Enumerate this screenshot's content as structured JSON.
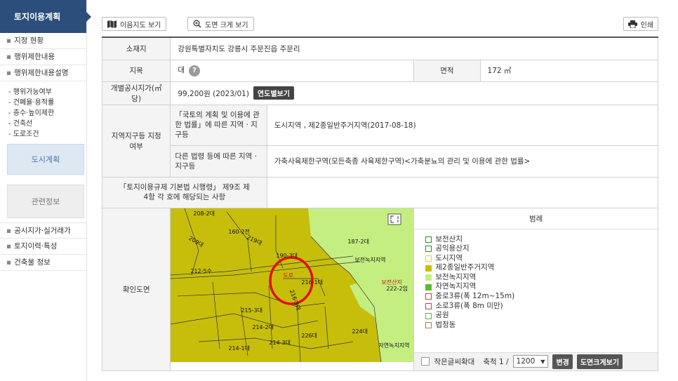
{
  "sidebar": {
    "header": "토지이용계획",
    "items_top": [
      "지정 현황",
      "행위제한내용",
      "행위제한내용설명"
    ],
    "sub_items": [
      "- 행위가능여부",
      "- 건폐율·용적률",
      "- 층수·높이제한",
      "- 건축선",
      "- 도로조건"
    ],
    "box_city": "도시계획",
    "box_related": "관련정보",
    "items_bottom": [
      "공시지가·실거래가",
      "토지이력·특성",
      "건축물 정보"
    ]
  },
  "toolbar": {
    "map_button": "이음지도 보기",
    "zoom_button": "도면 크게 보기",
    "print_button": "인쇄"
  },
  "info": {
    "location_label": "소재지",
    "location_value": "강원특별자치도 강릉시 주문진읍 주문리",
    "jimok_label": "지목",
    "jimok_value": "대",
    "area_label": "면적",
    "area_value": "172 ㎡",
    "price_label": "개별공시지가(㎡당)",
    "price_value": "99,200원 (2023/01)",
    "price_badge": "연도별보기",
    "zone_label": "지역지구등 지정여부",
    "zone1_label": "「국토의 계획 및 이용에 관한 법률」에 따른 지역 · 지구등",
    "zone1_value": "도시지역 , 제2종일반주거지역(2017-08-18)",
    "zone2_label": "다른 법령 등에 따른 지역 · 지구등",
    "zone2_value": "가축사육제한구역(모든축종 사육제한구역)<가축분뇨의 관리 및 이용에 관한 법률>",
    "enforce_label": "「토지이용규제 기본법 시행령」 제9조 제4항 각 호에 해당되는 사항",
    "enforce_value": "",
    "map_label": "확인도면"
  },
  "map": {
    "labels": [
      "208-2대",
      "160-2전",
      "209대",
      "219대",
      "190-3대",
      "187-2대",
      "보전녹지지역",
      "212-5수",
      "216-1대",
      "216-3대",
      "215-3대",
      "214-2대",
      "226대",
      "214-1대",
      "214-3대",
      "224대",
      "222-2임",
      "보전산지",
      "자연녹지지역",
      "도로"
    ],
    "expand_icon": "expand-icon"
  },
  "legend": {
    "title": "범례",
    "items": [
      {
        "label": "보전산지",
        "color": "#2f8f2f",
        "fill": "none"
      },
      {
        "label": "공익용산지",
        "color": "#2f8f2f",
        "fill": "none"
      },
      {
        "label": "도시지역",
        "color": "#e6d33a",
        "fill": "none"
      },
      {
        "label": "제2종일반주거지역",
        "color": "#c9bd0d",
        "fill": "#c9bd0d"
      },
      {
        "label": "보전녹지지역",
        "color": "#c5ee80",
        "fill": "#c5ee80"
      },
      {
        "label": "자연녹지지역",
        "color": "#5cbb2a",
        "fill": "#5cbb2a"
      },
      {
        "label": "중로3류(폭 12m~15m)",
        "color": "#d83a3a",
        "fill": "none"
      },
      {
        "label": "소로3류(폭 8m 미만)",
        "color": "#d83a3a",
        "fill": "none"
      },
      {
        "label": "공원",
        "color": "#5cbb2a",
        "fill": "none"
      },
      {
        "label": "법정동",
        "color": "#b07a5a",
        "fill": "none"
      }
    ],
    "small_text": "작은글씨확대",
    "scale_label": "축척 1 /",
    "scale_value": "1200",
    "change_button": "변경",
    "large_view_button": "도면크게보기"
  }
}
